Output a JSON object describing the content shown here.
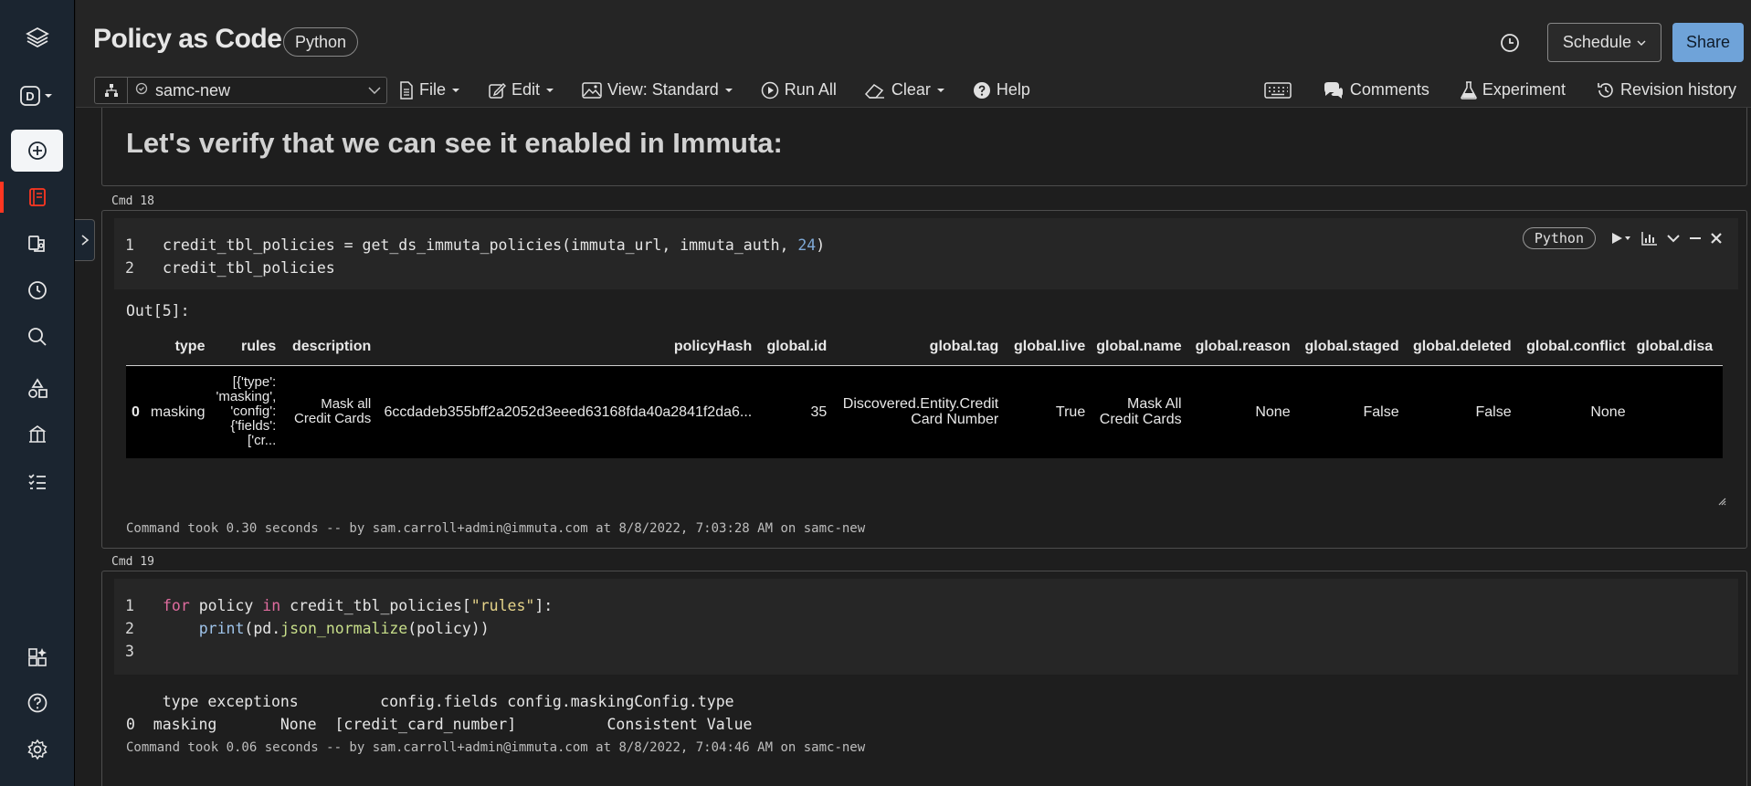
{
  "notebook": {
    "title": "Policy as Code",
    "language": "Python"
  },
  "header": {
    "schedule_label": "Schedule",
    "share_label": "Share"
  },
  "cluster": {
    "name": "samc-new"
  },
  "menu": {
    "file": "File",
    "edit": "Edit",
    "view": "View: Standard",
    "run_all": "Run All",
    "clear": "Clear",
    "help": "Help",
    "comments": "Comments",
    "experiment": "Experiment",
    "revision_history": "Revision history"
  },
  "rail": {
    "items": [
      "layers-logo-icon",
      "workspace-switcher-icon",
      "create-icon",
      "notebook-icon",
      "data-icon",
      "recents-icon",
      "search-icon",
      "shapes-icon",
      "workflows-icon",
      "tasks-icon",
      "partner-icon",
      "help-icon",
      "settings-icon"
    ],
    "workspace_letter": "D"
  },
  "cells": {
    "markdown": {
      "heading": "Let's verify that we can see it enabled in Immuta:"
    },
    "cmd18": {
      "label": "Cmd 18",
      "language": "Python",
      "lines": [
        {
          "n": "1",
          "text": "credit_tbl_policies = get_ds_immuta_policies(immuta_url, immuta_auth, 24)"
        },
        {
          "n": "2",
          "text": "credit_tbl_policies"
        }
      ],
      "out_label": "Out[5]:",
      "table": {
        "columns": [
          "",
          "type",
          "rules",
          "description",
          "policyHash",
          "global.id",
          "global.tag",
          "global.live",
          "global.name",
          "global.reason",
          "global.staged",
          "global.deleted",
          "global.conflict",
          "global.disa"
        ],
        "rows": [
          [
            "0",
            "masking",
            "[{'type': 'masking', 'config': {'fields': ['cr...",
            "Mask all Credit Cards",
            "6ccdadeb355bff2a2052d3eeed63168fda40a2841f2da6...",
            "35",
            "Discovered.Entity.Credit Card Number",
            "True",
            "Mask All Credit Cards",
            "None",
            "False",
            "False",
            "None",
            ""
          ]
        ]
      },
      "took": "Command took 0.30 seconds -- by sam.carroll+admin@immuta.com at 8/8/2022, 7:03:28 AM on samc-new"
    },
    "cmd19": {
      "label": "Cmd 19",
      "lines": [
        {
          "n": "1"
        },
        {
          "n": "2"
        },
        {
          "n": "3"
        }
      ],
      "output_header": "    type exceptions         config.fields config.maskingConfig.type",
      "output_row": "0  masking       None  [credit_card_number]          Consistent Value",
      "took": "Command took 0.06 seconds -- by sam.carroll+admin@immuta.com at 8/8/2022, 7:04:46 AM on samc-new"
    }
  },
  "colors": {
    "accent_red": "#ff3621",
    "share_blue": "#6fa3d9",
    "rail_bg": "#1b2530"
  }
}
